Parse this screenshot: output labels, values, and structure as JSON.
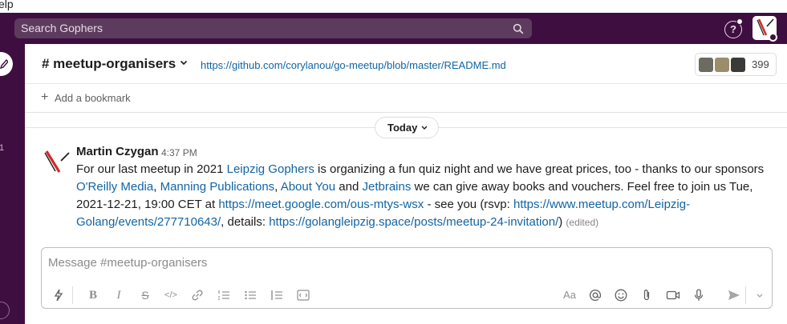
{
  "menubar": {
    "text": "elp"
  },
  "search": {
    "placeholder": "Search Gophers"
  },
  "sidebar": {
    "partial_number": "1"
  },
  "channel": {
    "name": "# meetup-organisers",
    "topic_link": "https://github.com/corylanou/go-meetup/blob/master/README.md",
    "member_count": "399"
  },
  "bookmarks": {
    "plus": "+",
    "add_label": "Add a bookmark"
  },
  "date_divider": {
    "label": "Today"
  },
  "message": {
    "author": "Martin Czygan",
    "time": "4:37 PM",
    "segments": [
      {
        "text": "For our last meetup in 2021 ",
        "link": false
      },
      {
        "text": "Leipzig Gophers",
        "link": true
      },
      {
        "text": " is organizing a fun quiz night and we have great prices, too - thanks to our sponsors ",
        "link": false
      },
      {
        "text": "O'Reilly Media",
        "link": true
      },
      {
        "text": ", ",
        "link": false
      },
      {
        "text": "Manning Publications",
        "link": true
      },
      {
        "text": ", ",
        "link": false
      },
      {
        "text": "About You",
        "link": true
      },
      {
        "text": " and ",
        "link": false
      },
      {
        "text": "Jetbrains",
        "link": true
      },
      {
        "text": " we can give away books and vouchers. Feel free to join us Tue, 2021-12-21, 19:00 CET at ",
        "link": false
      },
      {
        "text": "https://meet.google.com/ous-mtys-wsx",
        "link": true
      },
      {
        "text": " - see you (rsvp: ",
        "link": false
      },
      {
        "text": "https://www.meetup.com/Leipzig-Golang/events/277710643/",
        "link": true
      },
      {
        "text": ", details: ",
        "link": false
      },
      {
        "text": "https://golangleipzig.space/posts/meetup-24-invitation/",
        "link": true
      },
      {
        "text": ")",
        "link": false
      }
    ],
    "edited_label": "(edited)"
  },
  "composer": {
    "placeholder": "Message #meetup-organisers",
    "format_text_label": "Aa"
  },
  "colors": {
    "aubergine": "#3f0e40",
    "search_bg": "#5d3b5e",
    "link": "#1264a3",
    "text": "#1d1c1d",
    "muted": "#616061"
  }
}
